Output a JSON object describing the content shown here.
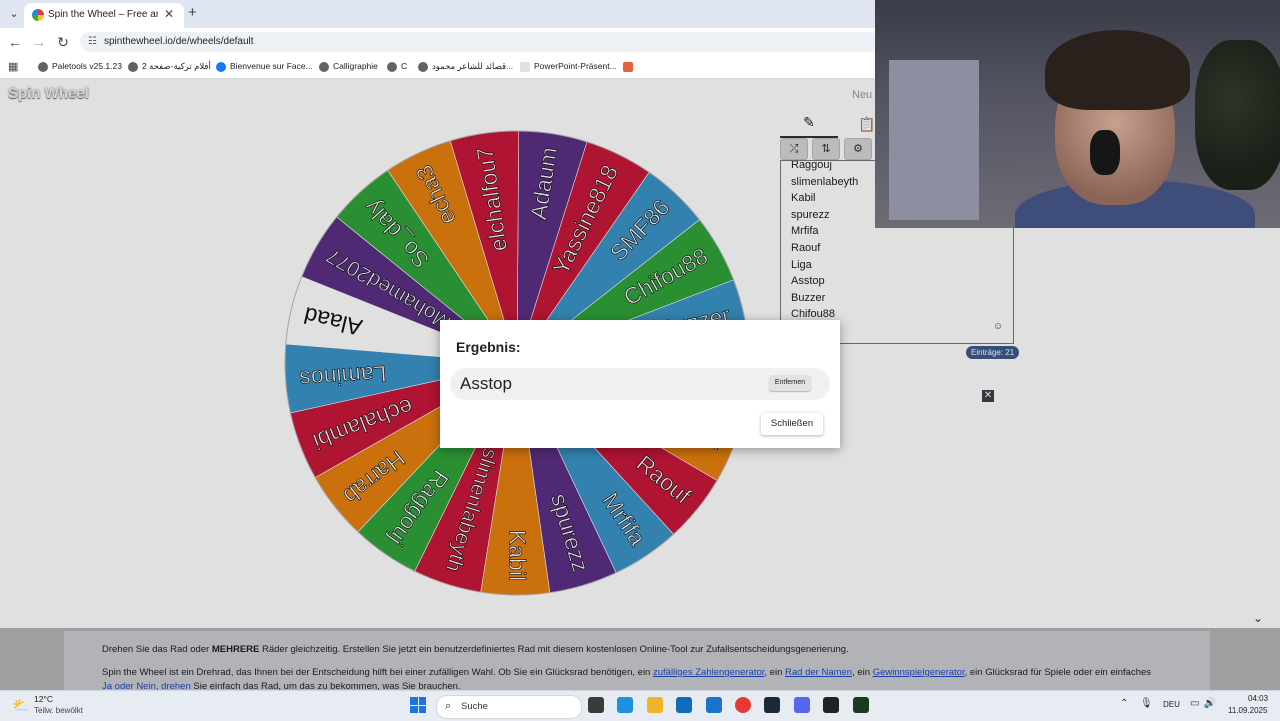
{
  "browser": {
    "tab_title": "Spin the Wheel – Free and easy",
    "url": "spinthewheel.io/de/wheels/default",
    "bookmarks": [
      "Paletools v25.1.23",
      "أفلام تركية-صفحة 2",
      "Bienvenue sur Face...",
      "Calligraphie",
      "C",
      "قصائد للشاعر محمود...",
      "PowerPoint-Präsent..."
    ],
    "icons": {
      "back": "back-arrow-icon",
      "forward": "forward-arrow-icon",
      "reload": "reload-icon",
      "apps": "apps-grid-icon"
    }
  },
  "page": {
    "logo": "Spin Wheel",
    "new_link": "Neu"
  },
  "wheel": {
    "segments": [
      {
        "label": "Adaum",
        "color": "#5b2f83"
      },
      {
        "label": "Yassine818",
        "color": "#c8173a"
      },
      {
        "label": "SMF86",
        "color": "#3b93c7"
      },
      {
        "label": "Chifou88",
        "color": "#2fa33a"
      },
      {
        "label": "Buzzer",
        "color": "#3b93c7"
      },
      {
        "label": "Asstop",
        "color": "#3b93c7"
      },
      {
        "label": "Liga",
        "color": "#e6800e"
      },
      {
        "label": "Raouf",
        "color": "#c8173a"
      },
      {
        "label": "Mrfifa",
        "color": "#3b93c7"
      },
      {
        "label": "spurezz",
        "color": "#5b2f83"
      },
      {
        "label": "Kabil",
        "color": "#e6800e"
      },
      {
        "label": "slimenlabeyth",
        "color": "#c8173a"
      },
      {
        "label": "Raggouj",
        "color": "#2fa33a"
      },
      {
        "label": "Harrab",
        "color": "#e6800e"
      },
      {
        "label": "echalambi",
        "color": "#c8173a"
      },
      {
        "label": "Laminos",
        "color": "#3b93c7"
      },
      {
        "label": "Alaad",
        "color": "#ffffff"
      },
      {
        "label": "Mohamed2077",
        "color": "#5b2f83"
      },
      {
        "label": "So_daly",
        "color": "#2fa33a"
      },
      {
        "label": "echa3",
        "color": "#e6800e"
      },
      {
        "label": "elchalfou7",
        "color": "#c8173a"
      }
    ]
  },
  "entries": {
    "items": [
      "Raggouj",
      "slimenlabeyth",
      "Kabil",
      "spurezz",
      "Mrfifa",
      "Raouf",
      "Liga",
      "Asstop",
      "Buzzer",
      "Chifou88"
    ],
    "count_label": "Einträge: 21",
    "icons": {
      "edit": "pencil-icon",
      "results": "clipboard-icon",
      "shuffle": "shuffle-icon",
      "sort": "sort-icon",
      "settings": "gear-icon",
      "emoji": "smiley-icon"
    }
  },
  "dialog": {
    "title": "Ergebnis:",
    "winner": "Asstop",
    "remove_label": "Entfernen",
    "close_label": "Schließen"
  },
  "info": {
    "p1_before": "Drehen Sie das Rad oder ",
    "p1_bold": "MEHRERE",
    "p1_after": " Räder gleichzeitig. Erstellen Sie jetzt ein benutzerdefiniertes Rad mit diesem kostenlosen Online-Tool zur Zufallsentscheidungsgenerierung.",
    "p2_a": "Spin the Wheel ist ein Drehrad, das Ihnen bei der Entscheidung hilft bei einer zufälligen Wahl. Ob Sie ein Glücksrad benötigen, ein ",
    "p2_link1": "zufälliges Zahlengenerator",
    "p2_b": ", ein ",
    "p2_link2": "Rad der Namen",
    "p2_c": ", ein ",
    "p2_link3": "Gewinnspielgenerator",
    "p2_d": ", ein Glücksrad für Spiele oder ein einfaches ",
    "p2_link4": "Ja oder Nein, drehen",
    "p2_e": " Sie einfach das Rad, um das zu bekommen, was Sie brauchen."
  },
  "taskbar": {
    "weather_temp": "12°C",
    "weather_desc": "Teilw. bewölkt",
    "search_placeholder": "Suche",
    "language": "DEU",
    "time": "04:03",
    "date": "11.09.2025",
    "app_colors": [
      "#3a3a3a",
      "#1f8fe0",
      "#f0b429",
      "#0f6cbd",
      "#1a73c9",
      "#e53935",
      "#1b2838",
      "#5865f2",
      "#222222",
      "#1e3a1e"
    ]
  }
}
